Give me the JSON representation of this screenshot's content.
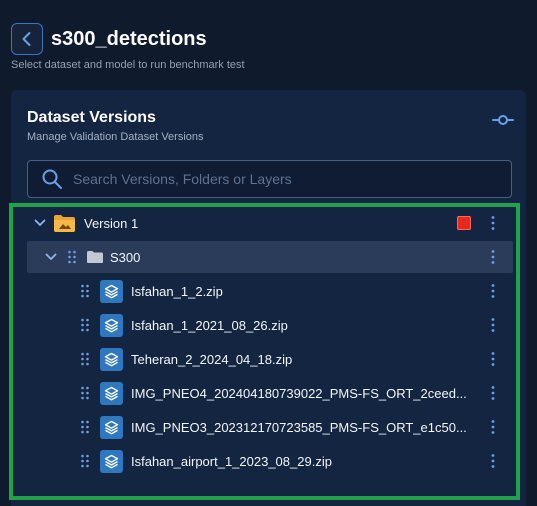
{
  "header": {
    "title": "s300_detections",
    "subtitle": "Select dataset and model to run benchmark test"
  },
  "panel": {
    "title": "Dataset Versions",
    "subtitle": "Manage Validation Dataset Versions",
    "search": {
      "placeholder": "Search Versions, Folders or Layers",
      "value": ""
    }
  },
  "tree": {
    "version": {
      "label": "Version 1",
      "icon": "folder-image-icon",
      "status_color": "#e8271f"
    },
    "folder": {
      "label": "S300",
      "icon": "folder-icon"
    },
    "files": [
      {
        "label": "Isfahan_1_2.zip"
      },
      {
        "label": "Isfahan_1_2021_08_26.zip"
      },
      {
        "label": "Teheran_2_2024_04_18.zip"
      },
      {
        "label": "IMG_PNEO4_202404180739022_PMS-FS_ORT_2ceed..."
      },
      {
        "label": "IMG_PNEO3_202312170723585_PMS-FS_ORT_e1c50..."
      },
      {
        "label": "Isfahan_airport_1_2023_08_29.zip"
      }
    ]
  },
  "colors": {
    "accent": "#3b74c4",
    "highlight": "#1fa24a",
    "background": "#0f1a2c",
    "panel": "#142541"
  }
}
